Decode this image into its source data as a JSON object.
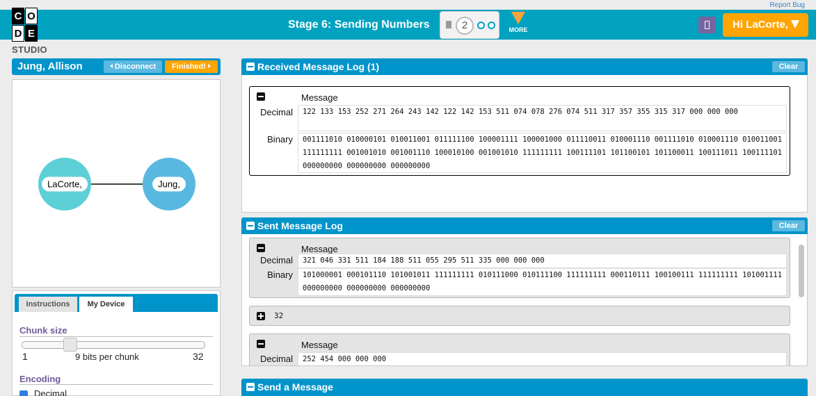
{
  "header": {
    "report_bug": "Report Bug",
    "logo_letters": [
      "C",
      "O",
      "D",
      "E"
    ],
    "logo_studio": "STUDIO",
    "stage_title": "Stage 6: Sending Numbers",
    "progress_current": "2",
    "more_label": "MORE",
    "user_button": "Hi LaCorte,"
  },
  "connection": {
    "partner_name": "Jung, Allison",
    "disconnect_label": "Disconnect",
    "finished_label": "Finished!"
  },
  "network": {
    "node_a": "LaCorte,",
    "node_b": "Jung,"
  },
  "device": {
    "tabs": [
      "Instructions",
      "My Device"
    ],
    "active_tab": "My Device",
    "chunk_size_title": "Chunk size",
    "chunk_min": "1",
    "chunk_max": "32",
    "chunk_value_label": "9 bits per chunk",
    "chunk_value": 9,
    "encoding_title": "Encoding",
    "encoding_decimal": "Decimal",
    "encoding_decimal_checked": true
  },
  "received": {
    "title": "Received Message Log (1)",
    "clear_label": "Clear",
    "packets": [
      {
        "message_label": "Message",
        "decimal_label": "Decimal",
        "binary_label": "Binary",
        "decimal": "122 133 153 252 271 264 243 142 122 142 153 511 074 078 276 074 511 317 357 355 315 317 000 000 000",
        "binary": "001111010 010000101 010011001 011111100 100001111 100001000 011110011 010001110 001111010 010001110 010011001 111111111 001001010 001001110 100010100 001001010 111111111 100111101 101100101 101100011 100111011 100111101 000000000 000000000 000000000"
      }
    ]
  },
  "sent": {
    "title": "Sent Message Log",
    "clear_label": "Clear",
    "packets": [
      {
        "message_label": "Message",
        "decimal_label": "Decimal",
        "binary_label": "Binary",
        "decimal": "321 046 331 511 184 188 511 055 295 511 335 000 000 000",
        "binary": "101000001 000101110 101001011 111111111 010111000 010111100 111111111 000110111 100100111 111111111 101001111 000000000 000000000 000000000"
      },
      {
        "collapsed_value": "32"
      },
      {
        "message_label": "Message",
        "decimal_label": "Decimal",
        "decimal": "252 454 000 000 000"
      }
    ]
  },
  "send": {
    "title": "Send a Message"
  },
  "colors": {
    "header_teal": "#00a2c0",
    "panel_blue": "#0094ca",
    "orange": "#ffa400",
    "purple": "#7665a0"
  }
}
